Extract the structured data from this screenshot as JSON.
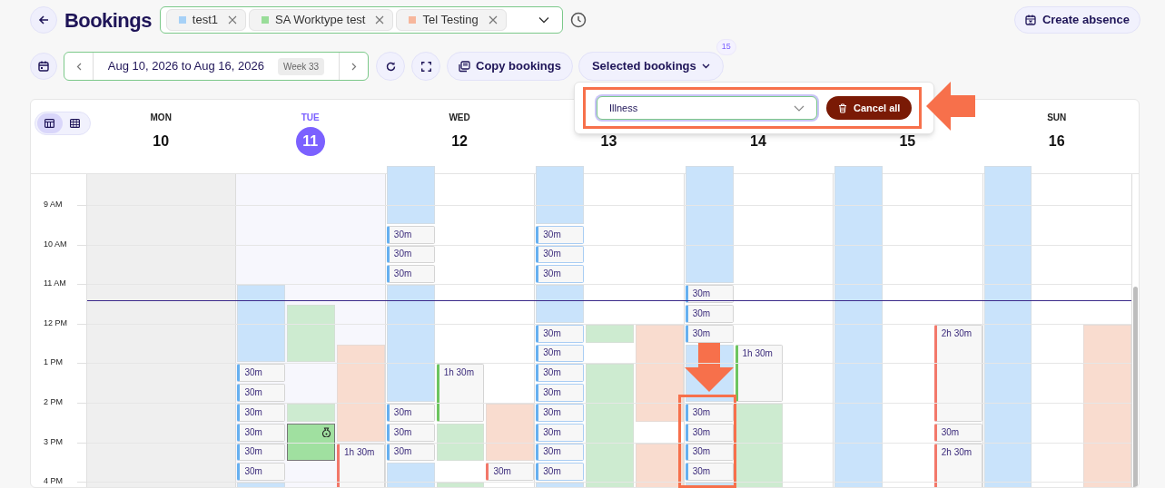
{
  "title": "Bookings",
  "services": [
    {
      "label": "test1",
      "color": "#a6d1f7"
    },
    {
      "label": "SA Worktype test",
      "color": "#99dd99"
    },
    {
      "label": "Tel Testing",
      "color": "#f7b79c"
    }
  ],
  "create_button": "Create absence",
  "date_range": {
    "label": "Aug 10, 2026 to Aug 16, 2026",
    "week": "Week 33"
  },
  "copy_button": "Copy bookings",
  "selected_button": {
    "label": "Selected bookings",
    "count": "15"
  },
  "selected_popup": {
    "reason": "Illness",
    "cancel_button": "Cancel all",
    "framed": true
  },
  "view_toggle": [
    {
      "kind": "week",
      "selected": true
    },
    {
      "kind": "month",
      "selected": false
    }
  ],
  "hours": [
    "9 AM",
    "10 AM",
    "11 AM",
    "12 PM",
    "1 PM",
    "2 PM",
    "3 PM",
    "4 PM"
  ],
  "days": [
    {
      "dow": "MON",
      "date": "10",
      "today": false,
      "past": true
    },
    {
      "dow": "TUE",
      "date": "11",
      "today": true,
      "past": false,
      "lanes": [
        {
          "cells": [
            {
              "kind": "free"
            },
            {
              "kind": "free"
            },
            {
              "kind": "free"
            },
            {
              "kind": "free"
            },
            {
              "kind": "free"
            },
            {
              "kind": "free"
            },
            {
              "kind": "open"
            },
            {
              "kind": "open"
            },
            {
              "kind": "open"
            },
            {
              "kind": "open"
            },
            {
              "kind": "booking",
              "label": "30m",
              "selected": false
            },
            {
              "kind": "booking",
              "label": "30m",
              "selected": false
            },
            {
              "kind": "booking",
              "label": "30m",
              "selected": false
            },
            {
              "kind": "booking",
              "label": "30m",
              "selected": false
            },
            {
              "kind": "booking",
              "label": "30m",
              "selected": false
            },
            {
              "kind": "booking",
              "label": "30m",
              "selected": false
            },
            {
              "kind": "open"
            }
          ]
        },
        {
          "cells": [
            {
              "kind": "free"
            },
            {
              "kind": "free"
            },
            {
              "kind": "free"
            },
            {
              "kind": "free"
            },
            {
              "kind": "free"
            },
            {
              "kind": "free"
            },
            {
              "kind": "free"
            },
            {
              "kind": "open"
            },
            {
              "kind": "open"
            },
            {
              "kind": "open"
            },
            {
              "kind": "free"
            },
            {
              "kind": "free"
            },
            {
              "kind": "open"
            },
            {
              "kind": "held"
            },
            {
              "kind": "more"
            }
          ]
        },
        {
          "cells": [
            {
              "kind": "free"
            },
            {
              "kind": "free"
            },
            {
              "kind": "free"
            },
            {
              "kind": "free"
            },
            {
              "kind": "free"
            },
            {
              "kind": "free"
            },
            {
              "kind": "free"
            },
            {
              "kind": "free"
            },
            {
              "kind": "free"
            },
            {
              "kind": "open"
            },
            {
              "kind": "open"
            },
            {
              "kind": "open"
            },
            {
              "kind": "open"
            },
            {
              "kind": "open"
            },
            {
              "kind": "booking",
              "label": "1h 30m",
              "selected": false
            },
            {
              "kind": "more"
            },
            {
              "kind": "more"
            }
          ]
        }
      ]
    },
    {
      "dow": "WED",
      "date": "12",
      "today": false,
      "past": false,
      "lanes": [
        {
          "cells": [
            {
              "kind": "open"
            },
            {
              "kind": "open"
            },
            {
              "kind": "open"
            },
            {
              "kind": "booking",
              "label": "30m",
              "selected": false
            },
            {
              "kind": "booking",
              "label": "30m",
              "selected": false
            },
            {
              "kind": "booking",
              "label": "30m",
              "selected": false
            },
            {
              "kind": "open"
            },
            {
              "kind": "open"
            },
            {
              "kind": "open"
            },
            {
              "kind": "open"
            },
            {
              "kind": "open"
            },
            {
              "kind": "open"
            },
            {
              "kind": "booking",
              "label": "30m",
              "selected": false
            },
            {
              "kind": "booking",
              "label": "30m",
              "selected": false
            },
            {
              "kind": "booking",
              "label": "30m",
              "selected": false
            },
            {
              "kind": "open"
            },
            {
              "kind": "open"
            }
          ]
        },
        {
          "cells": [
            {
              "kind": "free"
            },
            {
              "kind": "free"
            },
            {
              "kind": "free"
            },
            {
              "kind": "free"
            },
            {
              "kind": "free"
            },
            {
              "kind": "free"
            },
            {
              "kind": "free"
            },
            {
              "kind": "free"
            },
            {
              "kind": "free"
            },
            {
              "kind": "free"
            },
            {
              "kind": "booking",
              "label": "1h 30m",
              "selected": false
            },
            {
              "kind": "more"
            },
            {
              "kind": "more"
            },
            {
              "kind": "open"
            },
            {
              "kind": "open"
            },
            {
              "kind": "free"
            },
            {
              "kind": "open"
            }
          ]
        },
        {
          "cells": [
            {
              "kind": "free"
            },
            {
              "kind": "free"
            },
            {
              "kind": "free"
            },
            {
              "kind": "free"
            },
            {
              "kind": "free"
            },
            {
              "kind": "free"
            },
            {
              "kind": "free"
            },
            {
              "kind": "free"
            },
            {
              "kind": "free"
            },
            {
              "kind": "free"
            },
            {
              "kind": "free"
            },
            {
              "kind": "free"
            },
            {
              "kind": "open"
            },
            {
              "kind": "open"
            },
            {
              "kind": "open"
            },
            {
              "kind": "booking",
              "label": "30m",
              "selected": false
            }
          ]
        }
      ]
    },
    {
      "date": "13",
      "today": false,
      "past": false,
      "lanes": [
        {
          "cells": [
            {
              "kind": "open"
            },
            {
              "kind": "open"
            },
            {
              "kind": "open"
            },
            {
              "kind": "booking",
              "label": "30m",
              "selected": true
            },
            {
              "kind": "booking",
              "label": "30m",
              "selected": true
            },
            {
              "kind": "booking",
              "label": "30m",
              "selected": true
            },
            {
              "kind": "open"
            },
            {
              "kind": "open"
            },
            {
              "kind": "booking",
              "label": "30m",
              "selected": true
            },
            {
              "kind": "booking",
              "label": "30m",
              "selected": true
            },
            {
              "kind": "booking",
              "label": "30m",
              "selected": true
            },
            {
              "kind": "booking",
              "label": "30m",
              "selected": true
            },
            {
              "kind": "booking",
              "label": "30m",
              "selected": true
            },
            {
              "kind": "booking",
              "label": "30m",
              "selected": true
            },
            {
              "kind": "booking",
              "label": "30m",
              "selected": true
            },
            {
              "kind": "booking",
              "label": "30m",
              "selected": true
            },
            {
              "kind": "open"
            }
          ]
        },
        {
          "cells": [
            {
              "kind": "free"
            },
            {
              "kind": "free"
            },
            {
              "kind": "free"
            },
            {
              "kind": "free"
            },
            {
              "kind": "free"
            },
            {
              "kind": "free"
            },
            {
              "kind": "free"
            },
            {
              "kind": "free"
            },
            {
              "kind": "open"
            },
            {
              "kind": "free"
            },
            {
              "kind": "open"
            },
            {
              "kind": "open"
            },
            {
              "kind": "open"
            },
            {
              "kind": "open"
            },
            {
              "kind": "open"
            },
            {
              "kind": "open"
            },
            {
              "kind": "open"
            }
          ]
        },
        {
          "cells": [
            {
              "kind": "free"
            },
            {
              "kind": "free"
            },
            {
              "kind": "free"
            },
            {
              "kind": "free"
            },
            {
              "kind": "free"
            },
            {
              "kind": "free"
            },
            {
              "kind": "free"
            },
            {
              "kind": "free"
            },
            {
              "kind": "open"
            },
            {
              "kind": "open"
            },
            {
              "kind": "open"
            },
            {
              "kind": "open"
            },
            {
              "kind": "open"
            },
            {
              "kind": "free"
            },
            {
              "kind": "open"
            },
            {
              "kind": "open"
            },
            {
              "kind": "open"
            }
          ]
        }
      ]
    },
    {
      "date": "14",
      "today": false,
      "past": false,
      "lanes": [
        {
          "cells": [
            {
              "kind": "open"
            },
            {
              "kind": "open"
            },
            {
              "kind": "open"
            },
            {
              "kind": "open"
            },
            {
              "kind": "open"
            },
            {
              "kind": "open"
            },
            {
              "kind": "booking",
              "label": "30m",
              "selected": false
            },
            {
              "kind": "booking",
              "label": "30m",
              "selected": false
            },
            {
              "kind": "booking",
              "label": "30m",
              "selected": false
            },
            {
              "kind": "open"
            },
            {
              "kind": "open"
            },
            {
              "kind": "open"
            },
            {
              "kind": "booking",
              "label": "30m",
              "selected": false,
              "framed": true
            },
            {
              "kind": "booking",
              "label": "30m",
              "selected": false,
              "framed": true
            },
            {
              "kind": "booking",
              "label": "30m",
              "selected": false,
              "framed": true
            },
            {
              "kind": "booking",
              "label": "30m",
              "selected": false,
              "framed": true
            },
            {
              "kind": "open"
            }
          ]
        },
        {
          "cells": [
            {
              "kind": "free"
            },
            {
              "kind": "free"
            },
            {
              "kind": "free"
            },
            {
              "kind": "free"
            },
            {
              "kind": "free"
            },
            {
              "kind": "free"
            },
            {
              "kind": "free"
            },
            {
              "kind": "free"
            },
            {
              "kind": "free"
            },
            {
              "kind": "booking",
              "label": "1h 30m",
              "selected": false
            },
            {
              "kind": "more"
            },
            {
              "kind": "more"
            },
            {
              "kind": "open"
            },
            {
              "kind": "open"
            },
            {
              "kind": "open"
            },
            {
              "kind": "open"
            },
            {
              "kind": "open"
            }
          ]
        },
        {
          "cells": [
            {
              "kind": "free"
            }
          ]
        }
      ]
    },
    {
      "date": "15",
      "today": false,
      "past": false,
      "lanes": [
        {
          "cells": [
            {
              "kind": "open"
            },
            {
              "kind": "open"
            },
            {
              "kind": "open"
            },
            {
              "kind": "open"
            },
            {
              "kind": "open"
            },
            {
              "kind": "open"
            },
            {
              "kind": "open"
            },
            {
              "kind": "open"
            },
            {
              "kind": "open"
            },
            {
              "kind": "open"
            },
            {
              "kind": "open"
            },
            {
              "kind": "open"
            },
            {
              "kind": "open"
            },
            {
              "kind": "open"
            },
            {
              "kind": "open"
            },
            {
              "kind": "open"
            },
            {
              "kind": "open"
            }
          ]
        },
        {
          "cells": [
            {
              "kind": "free"
            }
          ]
        },
        {
          "cells": [
            {
              "kind": "free"
            },
            {
              "kind": "free"
            },
            {
              "kind": "free"
            },
            {
              "kind": "free"
            },
            {
              "kind": "free"
            },
            {
              "kind": "free"
            },
            {
              "kind": "free"
            },
            {
              "kind": "free"
            },
            {
              "kind": "booking",
              "label": "2h 30m",
              "selected": false
            },
            {
              "kind": "more"
            },
            {
              "kind": "more"
            },
            {
              "kind": "more"
            },
            {
              "kind": "more"
            },
            {
              "kind": "booking",
              "label": "30m",
              "selected": false
            },
            {
              "kind": "booking",
              "label": "2h 30m",
              "selected": false
            },
            {
              "kind": "more"
            },
            {
              "kind": "more"
            }
          ]
        }
      ]
    },
    {
      "dow": "SUN",
      "date": "16",
      "today": false,
      "past": false,
      "lanes": [
        {
          "cells": [
            {
              "kind": "open"
            },
            {
              "kind": "open"
            },
            {
              "kind": "open"
            },
            {
              "kind": "open"
            },
            {
              "kind": "open"
            },
            {
              "kind": "open"
            },
            {
              "kind": "open"
            },
            {
              "kind": "open"
            },
            {
              "kind": "open"
            },
            {
              "kind": "open"
            },
            {
              "kind": "open"
            },
            {
              "kind": "open"
            },
            {
              "kind": "open"
            },
            {
              "kind": "open"
            },
            {
              "kind": "open"
            },
            {
              "kind": "open"
            },
            {
              "kind": "open"
            }
          ]
        },
        {
          "cells": [
            {
              "kind": "free"
            }
          ]
        },
        {
          "cells": [
            {
              "kind": "free"
            },
            {
              "kind": "free"
            },
            {
              "kind": "free"
            },
            {
              "kind": "free"
            },
            {
              "kind": "free"
            },
            {
              "kind": "free"
            },
            {
              "kind": "free"
            },
            {
              "kind": "free"
            },
            {
              "kind": "open"
            },
            {
              "kind": "open"
            },
            {
              "kind": "open"
            },
            {
              "kind": "open"
            },
            {
              "kind": "open"
            },
            {
              "kind": "open"
            },
            {
              "kind": "open"
            },
            {
              "kind": "open"
            },
            {
              "kind": "open"
            }
          ]
        }
      ]
    }
  ]
}
